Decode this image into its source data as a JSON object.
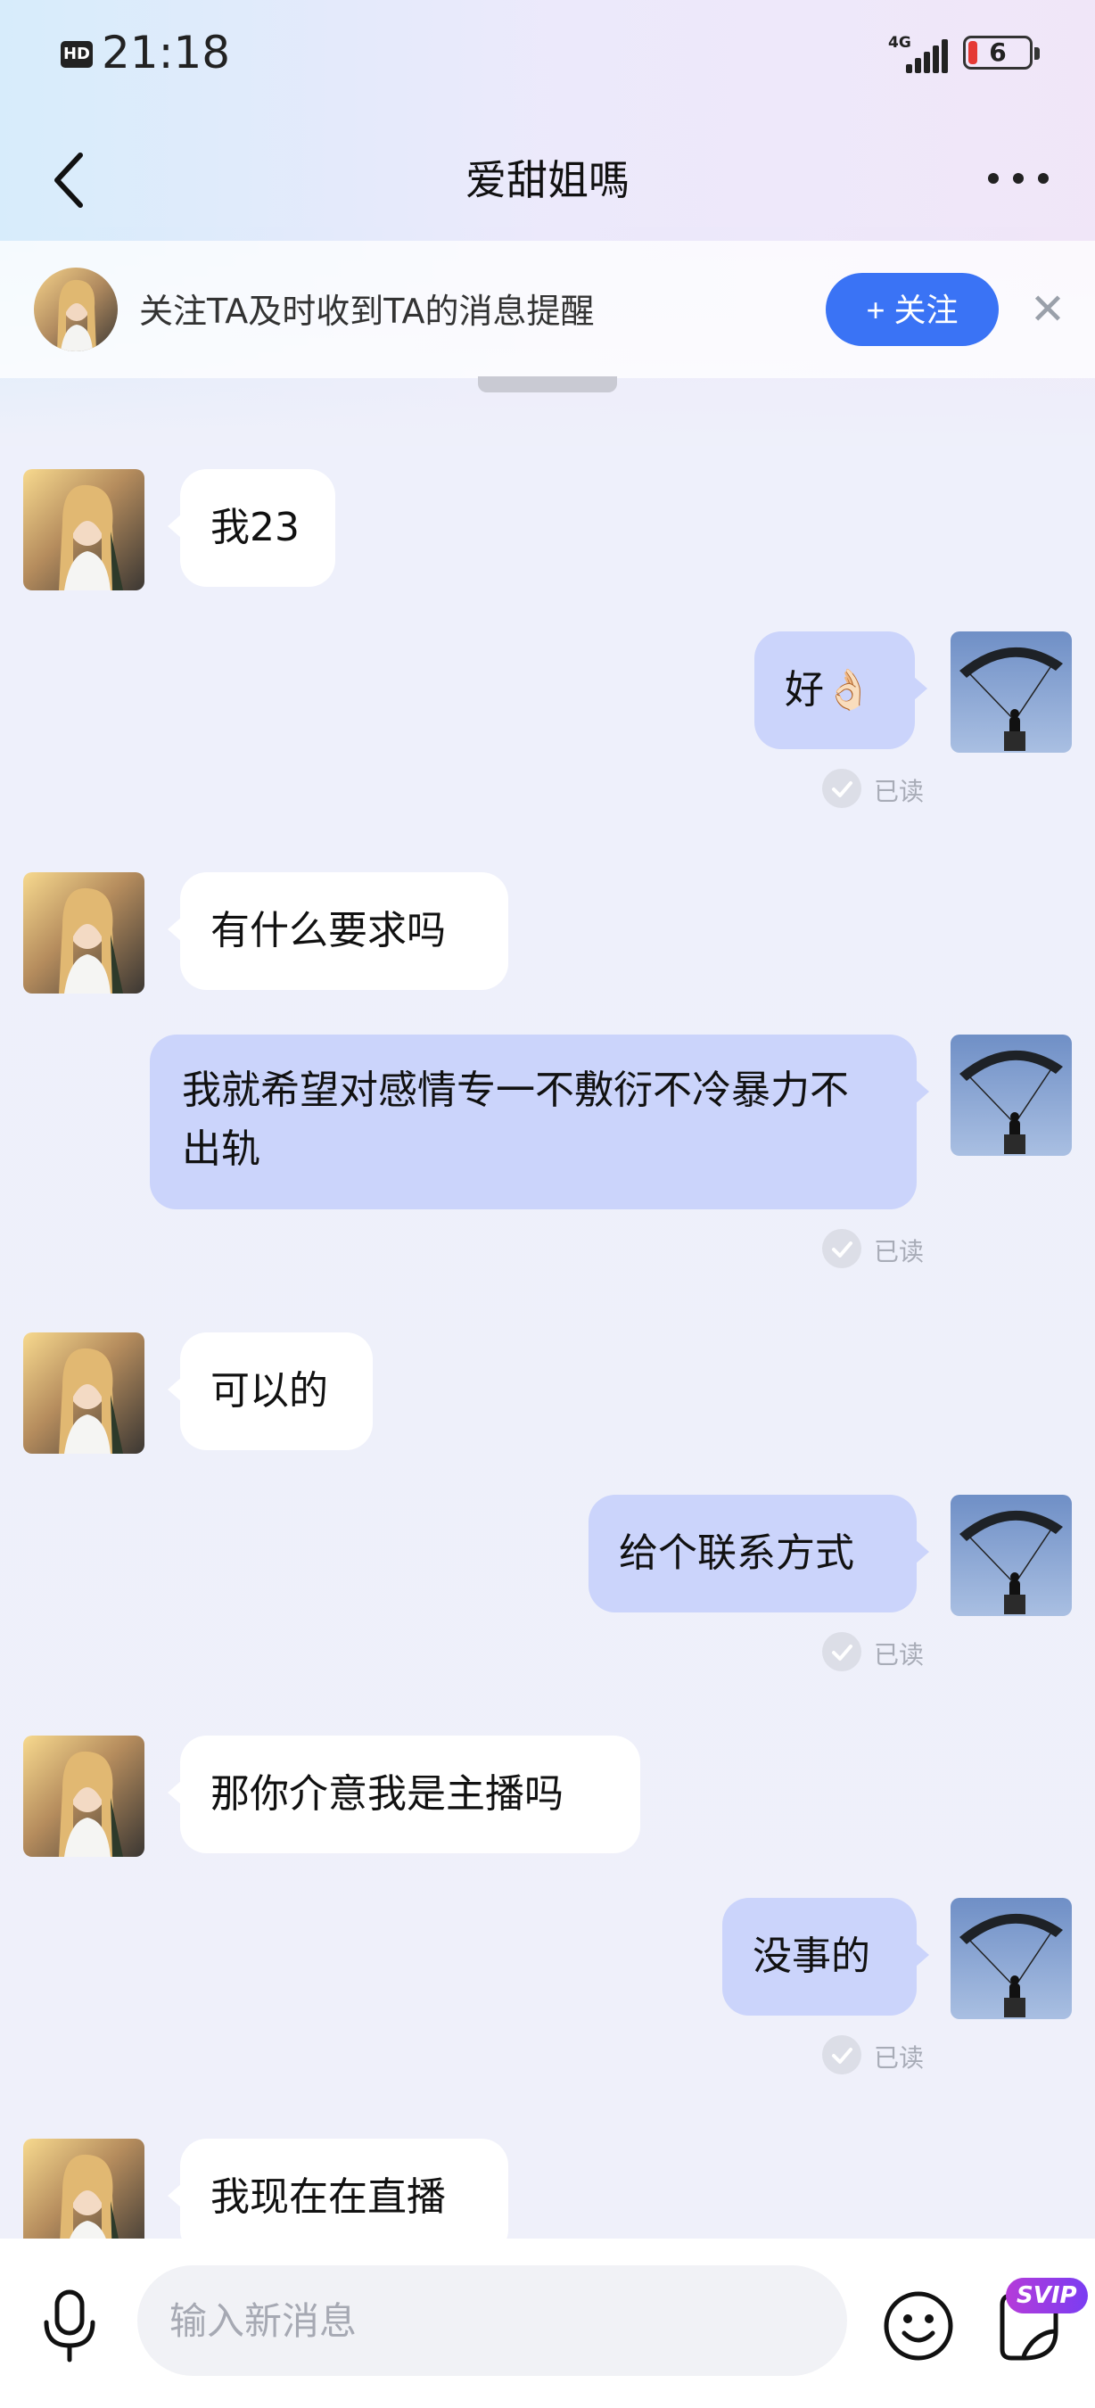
{
  "status_bar": {
    "hd_badge": "HD",
    "time": "21:18",
    "network": "4G",
    "battery": "6"
  },
  "header": {
    "title": "爱甜姐嗎",
    "back_icon": "chevron-left-icon",
    "more_icon": "more-horizontal-icon"
  },
  "follow_banner": {
    "text": "关注TA及时收到TA的消息提醒",
    "follow_label": "+ 关注",
    "close_glyph": "✕"
  },
  "messages": [
    {
      "side": "in",
      "text": "我23"
    },
    {
      "side": "out",
      "text": "好👌🏻",
      "read": "已读"
    },
    {
      "side": "in",
      "text": "有什么要求吗"
    },
    {
      "side": "out",
      "text": "我就希望对感情专一不敷衍不冷暴力不出轨",
      "read": "已读"
    },
    {
      "side": "in",
      "text": "可以的"
    },
    {
      "side": "out",
      "text": "给个联系方式",
      "read": "已读"
    },
    {
      "side": "in",
      "text": "那你介意我是主播吗"
    },
    {
      "side": "out",
      "text": "没事的",
      "read": "已读"
    },
    {
      "side": "in",
      "text": "我现在在直播"
    }
  ],
  "input_bar": {
    "placeholder": "输入新消息",
    "svip_badge": "SVIP"
  },
  "colors": {
    "accent": "#3a73f5",
    "outgoing_bubble": "#cbd4fb",
    "incoming_bubble": "#ffffff",
    "background": "#eff0fa"
  }
}
